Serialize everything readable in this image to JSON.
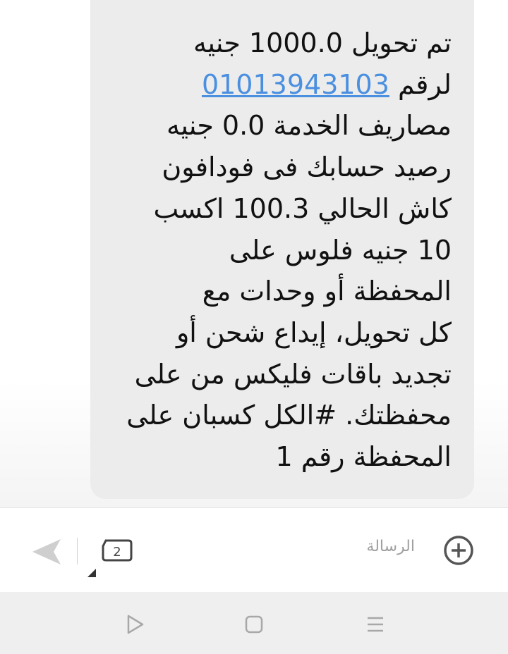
{
  "message": {
    "lines_before_link": [
      "تم تحويل 1000.0 جنيه"
    ],
    "link_prefix": "لرقم ",
    "phone_number": "01013943103",
    "lines_after_link": [
      "مصاريف الخدمة 0.0 جنيه",
      "رصيد حسابك فى فودافون",
      "كاش الحالي 100.3 اكسب",
      "10 جنيه فلوس على",
      "المحفظة أو وحدات  مع",
      "كل تحويل، إيداع شحن أو",
      "تجديد باقات فليكس من على",
      "محفظتك.  #الكل كسبان على",
      "المحفظة رقم 1"
    ]
  },
  "compose": {
    "placeholder": "الرسالة",
    "sim_number": "2"
  },
  "icons": {
    "send": "send-icon",
    "sim": "sim-card-icon",
    "add": "plus-circle-icon",
    "back": "nav-back-icon",
    "home": "nav-home-icon",
    "menu": "nav-menu-icon"
  },
  "colors": {
    "bubble": "#ececec",
    "link": "#4a8fe0",
    "nav_bar": "#efefef"
  }
}
